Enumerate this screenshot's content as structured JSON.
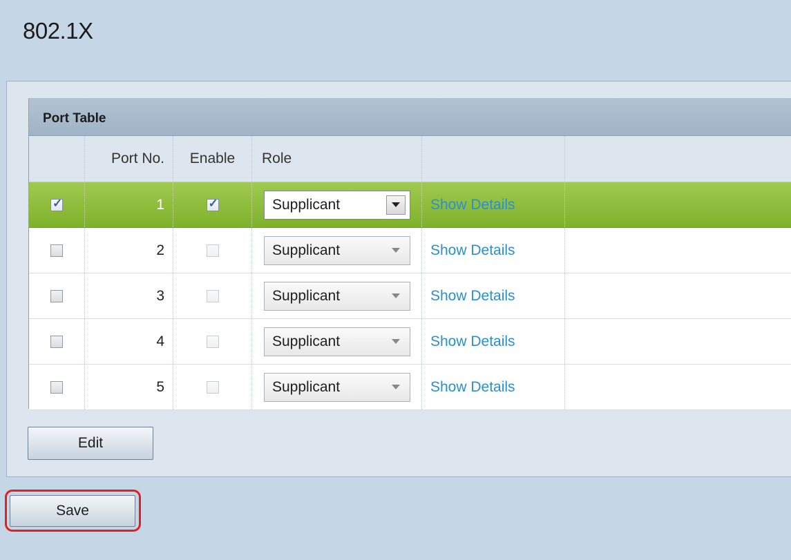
{
  "page": {
    "title": "802.1X"
  },
  "port_table": {
    "title": "Port Table",
    "columns": [
      "",
      "Port No.",
      "Enable",
      "Role",
      ""
    ],
    "rows": [
      {
        "selected": true,
        "port": "1",
        "enabled": true,
        "role": "Supplicant",
        "link": "Show Details"
      },
      {
        "selected": false,
        "port": "2",
        "enabled": false,
        "role": "Supplicant",
        "link": "Show Details"
      },
      {
        "selected": false,
        "port": "3",
        "enabled": false,
        "role": "Supplicant",
        "link": "Show Details"
      },
      {
        "selected": false,
        "port": "4",
        "enabled": false,
        "role": "Supplicant",
        "link": "Show Details"
      },
      {
        "selected": false,
        "port": "5",
        "enabled": false,
        "role": "Supplicant",
        "link": "Show Details"
      }
    ]
  },
  "buttons": {
    "edit_label": "Edit",
    "save_label": "Save"
  },
  "colors": {
    "page_background": "#c5d6e6",
    "selected_row": "#8fbf3a",
    "link": "#2a8fd0",
    "highlight": "#e12121"
  }
}
